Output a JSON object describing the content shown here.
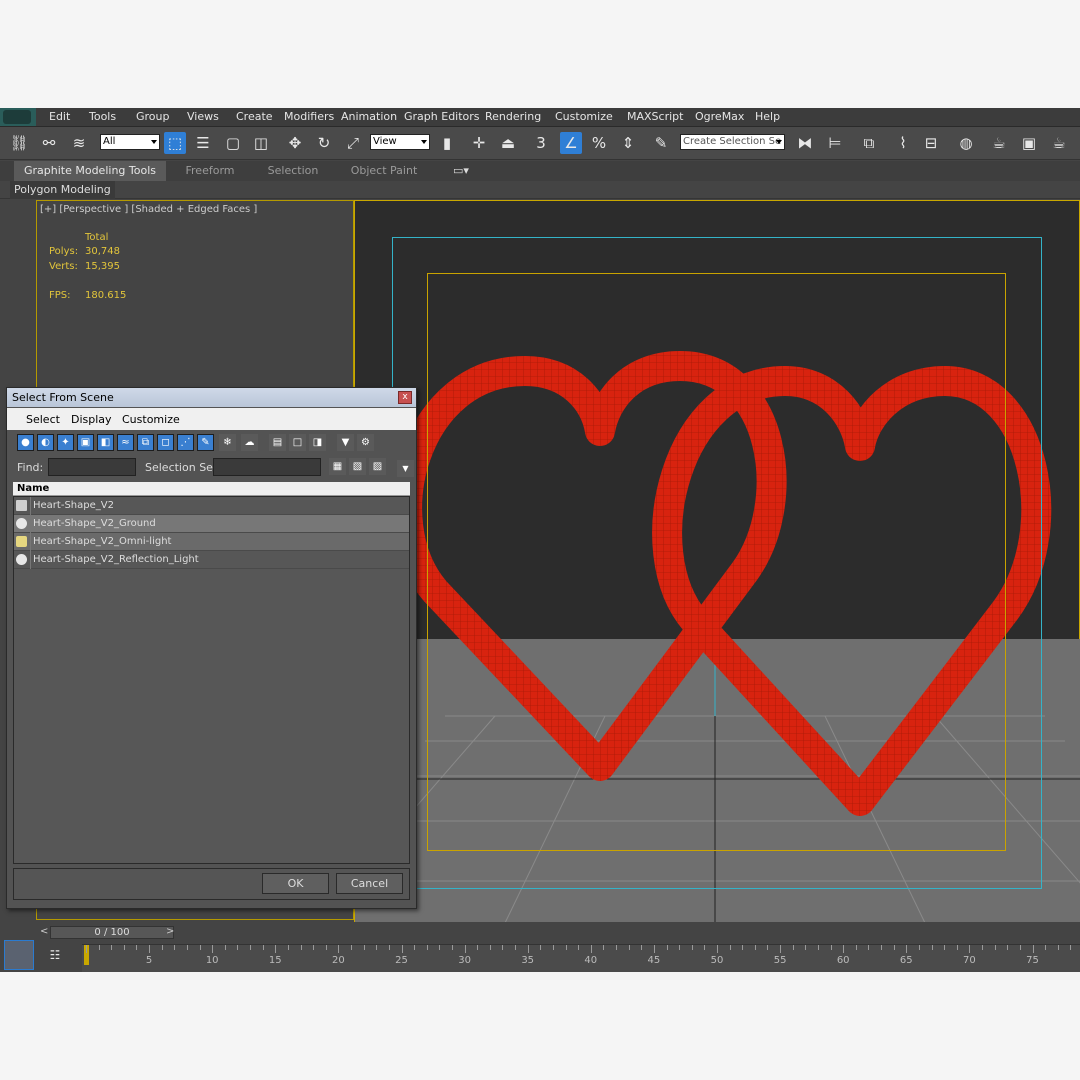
{
  "menubar": {
    "items": [
      "Edit",
      "Tools",
      "Group",
      "Views",
      "Create",
      "Modifiers",
      "Animation",
      "Graph Editors",
      "Rendering",
      "Customize",
      "MAXScript",
      "OgreMax",
      "Help"
    ]
  },
  "toolbar": {
    "filter_value": "All",
    "refcoord_value": "View",
    "snap_label": "3",
    "selection_set_placeholder": "Create Selection Se"
  },
  "ribbon": {
    "tabs": [
      "Graphite Modeling Tools",
      "Freeform",
      "Selection",
      "Object Paint"
    ],
    "subtab": "Polygon Modeling"
  },
  "viewport": {
    "label": "[+] [Perspective ] [Shaded + Edged Faces ]",
    "stats": {
      "total_label": "Total",
      "polys_label": "Polys:",
      "polys_value": "30,748",
      "verts_label": "Verts:",
      "verts_value": "15,395",
      "fps_label": "FPS:",
      "fps_value": "180.615"
    }
  },
  "colors": {
    "heart": "#d8230f",
    "heart_wire": "#b01a08",
    "safe_frame": "#34b3c8",
    "render_frame": "#c9a300"
  },
  "dialog": {
    "title": "Select From Scene",
    "close": "x",
    "menu": [
      "Select",
      "Display",
      "Customize"
    ],
    "find_label": "Find:",
    "selection_set_label": "Selection Set:",
    "column_header": "Name",
    "items": [
      {
        "name": "Heart-Shape_V2",
        "icon": "group-icon",
        "selected": false
      },
      {
        "name": "Heart-Shape_V2_Ground",
        "icon": "sphere-icon",
        "selected": true
      },
      {
        "name": "Heart-Shape_V2_Omni-light",
        "icon": "light-icon",
        "selected": true
      },
      {
        "name": "Heart-Shape_V2_Reflection_Light",
        "icon": "sphere-icon",
        "selected": false
      }
    ],
    "ok_label": "OK",
    "cancel_label": "Cancel"
  },
  "timeline": {
    "slider_text": "0 / 100",
    "prev": "<",
    "next": ">",
    "ticks": [
      5,
      10,
      15,
      20,
      25,
      30,
      35,
      40,
      45,
      50,
      55,
      60,
      65,
      70,
      75
    ]
  }
}
